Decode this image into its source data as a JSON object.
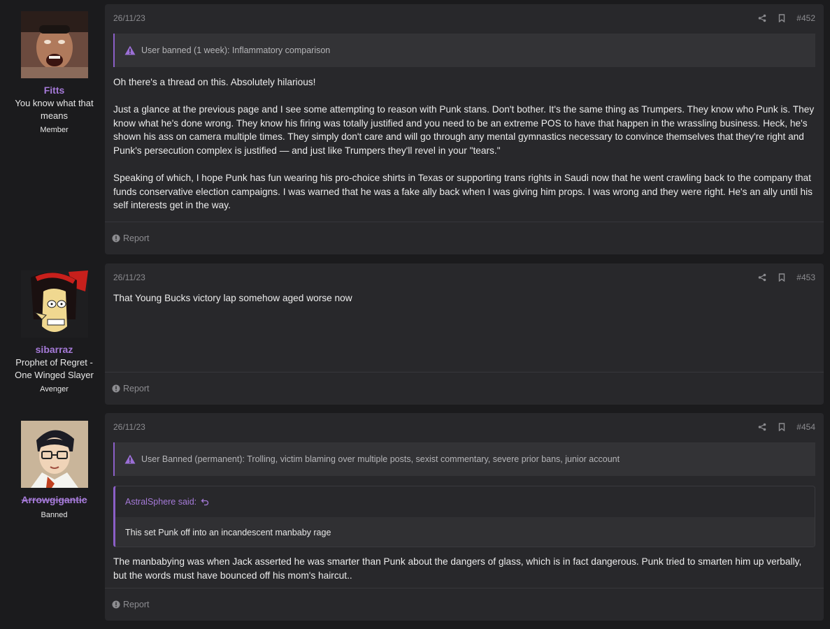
{
  "posts": [
    {
      "user": {
        "name": "Fitts",
        "title": "You know what that means",
        "role": "Member"
      },
      "date": "26/11/23",
      "number": "#452",
      "notice": "User banned (1 week): Inflammatory comparison",
      "paragraphs": [
        "Oh there's a thread on this. Absolutely hilarious!",
        "Just a glance at the previous page and I see some attempting to reason with Punk stans. Don't bother. It's the same thing as Trumpers. They know who Punk is. They know what he's done wrong. They know his firing was totally justified and you need to be an extreme POS to have that happen in the wrassling business. Heck, he's shown his ass on camera multiple times. They simply don't care and will go through any mental gymnastics necessary to convince themselves that they're right and Punk's persecution complex is justified — and just like Trumpers they'll revel in your \"tears.\"",
        "Speaking of which, I hope Punk has fun wearing his pro-choice shirts in Texas or supporting trans rights in Saudi now that he went crawling back to the company that funds conservative election campaigns. I was warned that he was a fake ally back when I was giving him props. I was wrong and they were right. He's an ally until his self interests get in the way."
      ],
      "report": "Report"
    },
    {
      "user": {
        "name": "sibarraz",
        "title": "Prophet of Regret - One Winged Slayer",
        "role": "Avenger"
      },
      "date": "26/11/23",
      "number": "#453",
      "paragraphs": [
        "That Young Bucks victory lap somehow aged worse now"
      ],
      "report": "Report"
    },
    {
      "user": {
        "name": "Arrowgigantic",
        "role": "Banned"
      },
      "date": "26/11/23",
      "number": "#454",
      "notice": "User Banned (permanent): Trolling, victim blaming over multiple posts, sexist commentary, severe prior bans, junior account",
      "quote": {
        "author": "AstralSphere said:",
        "text": "This set Punk off into an incandescent manbaby rage"
      },
      "paragraphs": [
        "The manbabying was when Jack asserted he was smarter than Punk about the dangers of glass, which is in fact dangerous. Punk tried to smarten him up verbally, but the words must have bounced off his mom's haircut.."
      ],
      "report": "Report"
    }
  ],
  "icons": {
    "share": "share-icon",
    "bookmark": "bookmark-icon",
    "warning": "warning-icon",
    "report": "report-icon",
    "quote_jump": "quote-jump-icon"
  },
  "colors": {
    "accent": "#a57ad8",
    "card": "#28282b",
    "background": "#1b1b1d"
  }
}
